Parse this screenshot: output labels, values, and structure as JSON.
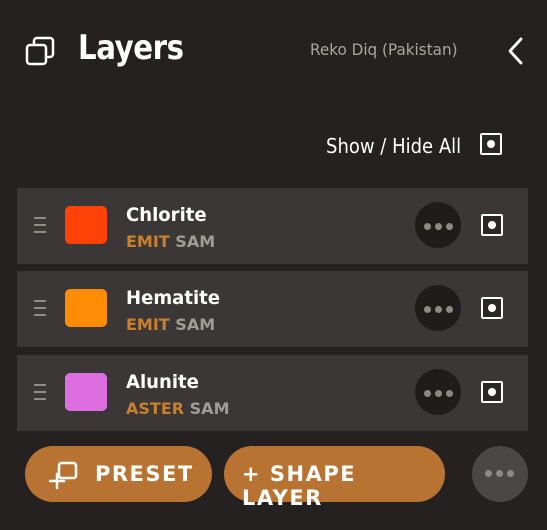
{
  "header": {
    "title": "Layers",
    "location": "Reko Diq (Pakistan)",
    "layers_icon": "layers-icon",
    "back_icon": "chevron-left-icon"
  },
  "show_hide": {
    "label": "Show / Hide All",
    "checked": true
  },
  "layers": [
    {
      "name": "Chlorite",
      "sensor": "EMIT",
      "method": "SAM",
      "color": "#ff4208",
      "visible": true
    },
    {
      "name": "Hematite",
      "sensor": "EMIT",
      "method": "SAM",
      "color": "#ff8c05",
      "visible": true
    },
    {
      "name": "Alunite",
      "sensor": "ASTER",
      "method": "SAM",
      "color": "#dc6ee0",
      "visible": true
    }
  ],
  "buttons": {
    "preset": "PRESET",
    "shape_layer": "+ SHAPE LAYER"
  },
  "colors": {
    "background": "#242120",
    "row": "#3a3736",
    "accent": "#b87333",
    "sensor_text": "#c9802e"
  }
}
